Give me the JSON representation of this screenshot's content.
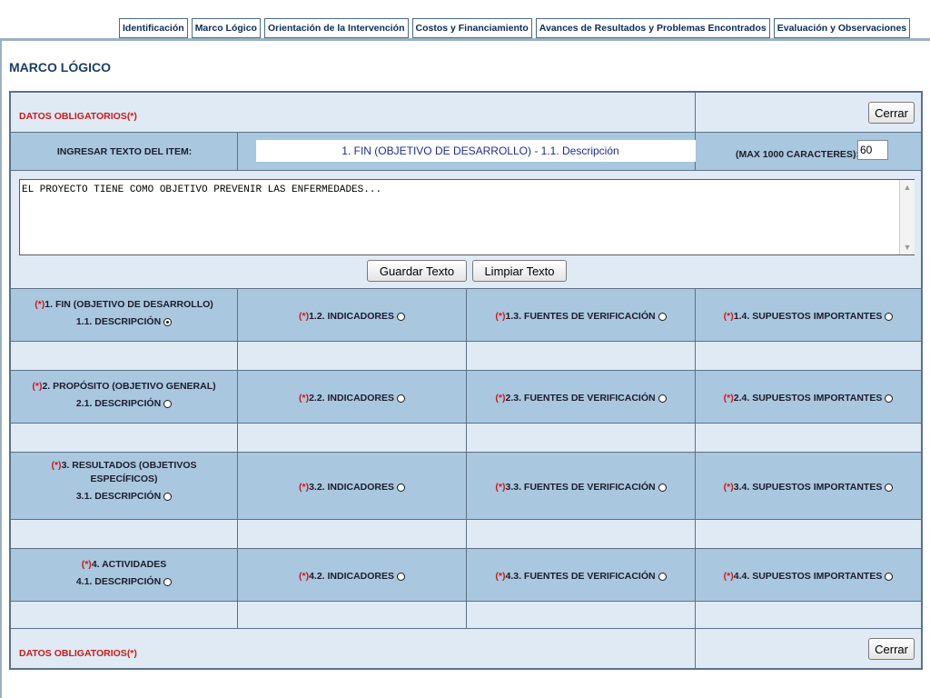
{
  "tabs": [
    "Identificación",
    "Marco Lógico",
    "Orientación de la Intervención",
    "Costos y Financiamiento",
    "Avances de Resultados y Problemas Encontrados",
    "Evaluación y Observaciones"
  ],
  "section_title": "MARCO LÓGICO",
  "required_note": {
    "text": "DATOS OBLIGATORIOS",
    "marker": "(*)"
  },
  "close_button": "Cerrar",
  "item_row": {
    "label": "INGRESAR TEXTO DEL ITEM:",
    "current_item": "1. FIN (OBJETIVO DE DESARROLLO) -  1.1. Descripción",
    "max_label": "(MAX 1000 CARACTERES):",
    "max_value": "60"
  },
  "textarea_value": "EL PROYECTO TIENE COMO OBJETIVO PREVENIR LAS ENFERMEDADES...",
  "buttons": {
    "save": "Guardar Texto",
    "clear": "Limpiar Texto"
  },
  "asterisk": "(*)",
  "rows": [
    {
      "title": [
        "1. FIN (OBJETIVO DE DESARROLLO)"
      ],
      "desc": "1.1. DESCRIPCIÓN",
      "desc_checked": true,
      "cols": [
        "1.2. INDICADORES",
        "1.3. FUENTES DE VERIFICACIÓN",
        "1.4. SUPUESTOS IMPORTANTES"
      ]
    },
    {
      "title": [
        "2. PROPÓSITO (OBJETIVO GENERAL)"
      ],
      "desc": "2.1. DESCRIPCIÓN",
      "desc_checked": false,
      "cols": [
        "2.2. INDICADORES",
        "2.3. FUENTES DE VERIFICACIÓN",
        "2.4. SUPUESTOS IMPORTANTES"
      ]
    },
    {
      "title": [
        "3. RESULTADOS (OBJETIVOS",
        "ESPECÍFICOS)"
      ],
      "desc": "3.1. DESCRIPCIÓN",
      "desc_checked": false,
      "cols": [
        "3.2. INDICADORES",
        "3.3. FUENTES DE VERIFICACIÓN",
        "3.4. SUPUESTOS IMPORTANTES"
      ]
    },
    {
      "title": [
        "4. ACTIVIDADES"
      ],
      "desc": "4.1. DESCRIPCIÓN",
      "desc_checked": false,
      "cols": [
        "4.2. INDICADORES",
        "4.3. FUENTES DE VERIFICACIÓN",
        "4.4. SUPUESTOS IMPORTANTES"
      ]
    }
  ],
  "colors": {
    "panel_bg": "#dfeaf5",
    "row_bg": "#a9c7de",
    "border": "#5c7188",
    "required": "#d01818",
    "title": "#1a3f6b"
  }
}
